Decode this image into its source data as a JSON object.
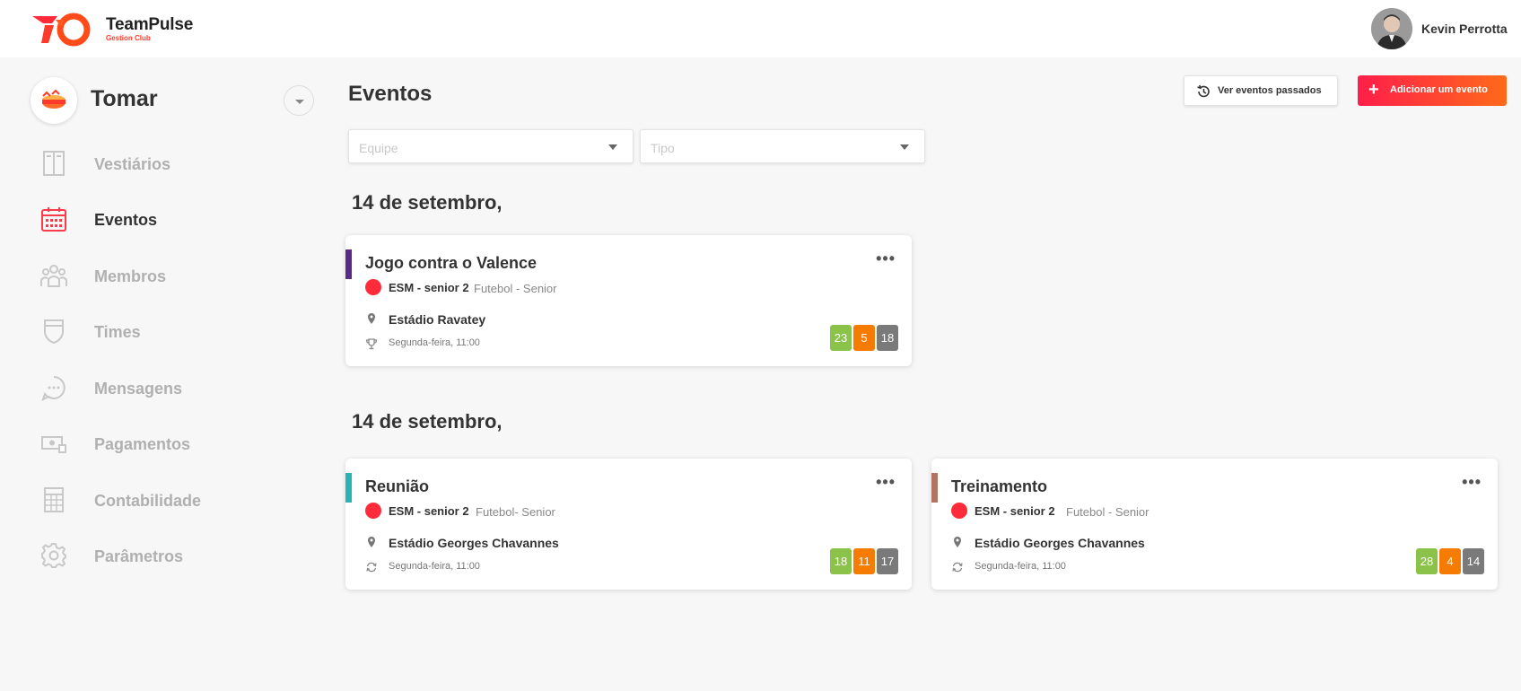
{
  "app": {
    "brand_name": "TeamPulse",
    "brand_sub": "Gestion Club",
    "accent_color": "#ff3a2a"
  },
  "user": {
    "name": "Kevin Perrotta",
    "avatar_icon": "user-avatar"
  },
  "club": {
    "name": "Tomar"
  },
  "sidebar": {
    "items": [
      {
        "label": "Vestiários",
        "icon": "locker-icon",
        "active": false
      },
      {
        "label": "Eventos",
        "icon": "calendar-icon",
        "active": true
      },
      {
        "label": "Membros",
        "icon": "members-icon",
        "active": false
      },
      {
        "label": "Times",
        "icon": "shield-icon",
        "active": false
      },
      {
        "label": "Mensagens",
        "icon": "chat-icon",
        "active": false
      },
      {
        "label": "Pagamentos",
        "icon": "payments-icon",
        "active": false
      },
      {
        "label": "Contabilidade",
        "icon": "calculator-icon",
        "active": false
      },
      {
        "label": "Parâmetros",
        "icon": "gear-icon",
        "active": false
      }
    ]
  },
  "main": {
    "title": "Eventos",
    "past_button": "Ver eventos passados",
    "add_button": "Adicionar um evento",
    "filters": {
      "team_placeholder": "Equipe",
      "type_placeholder": "Tipo"
    },
    "groups": [
      {
        "date": "14 de setembro,",
        "events": [
          {
            "title": "Jogo contra o Valence",
            "accent": "#5b2a86",
            "team": "ESM - senior 2",
            "meta": "Futebol - Senior",
            "location": "Estádio Ravatey",
            "when": "Segunda-feira, 11:00",
            "when_icon": "trophy-icon",
            "counts": {
              "yes": "23",
              "maybe": "5",
              "no": "18"
            }
          }
        ]
      },
      {
        "date": "14 de setembro,",
        "events": [
          {
            "title": "Reunião",
            "accent": "#2ab3b3",
            "team": "ESM - senior 2",
            "meta": "Futebol- Senior",
            "location": "Estádio Georges Chavannes",
            "when": "Segunda-feira, 11:00",
            "when_icon": "recurring-icon",
            "counts": {
              "yes": "18",
              "maybe": "11",
              "no": "17"
            }
          },
          {
            "title": "Treinamento",
            "accent": "#b07464",
            "team": "ESM - senior 2",
            "meta": "Futebol  - Senior",
            "location": "Estádio Georges Chavannes",
            "when": "Segunda-feira, 11:00",
            "when_icon": "recurring-icon",
            "counts": {
              "yes": "28",
              "maybe": "4",
              "no": "14"
            }
          }
        ]
      }
    ]
  }
}
